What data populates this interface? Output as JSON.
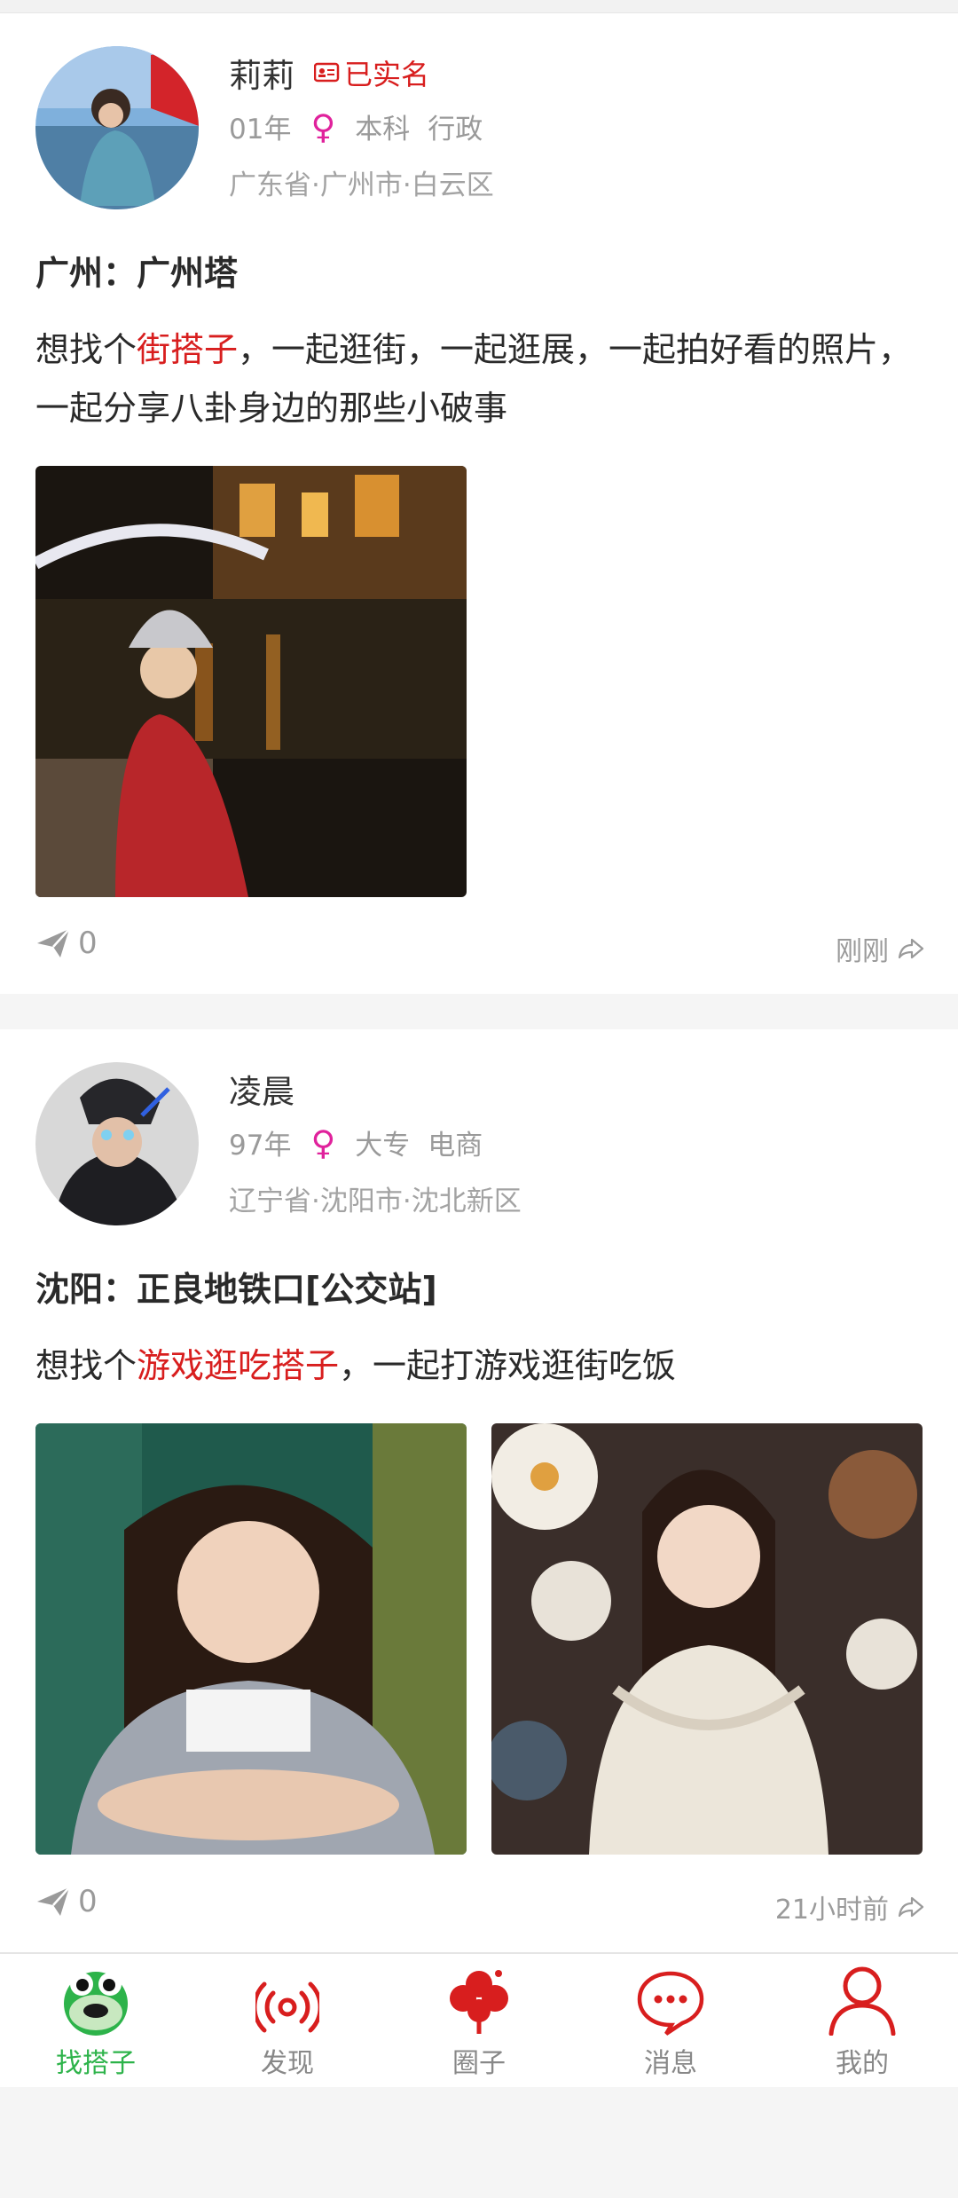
{
  "posts": [
    {
      "name": "莉莉",
      "verified_label": "已实名",
      "birth_year": "01年",
      "education": "本科",
      "job": "行政",
      "location": "广东省·广州市·白云区",
      "place": "广州：广州塔",
      "desc_prefix": "想找个",
      "desc_highlight": "街搭子",
      "desc_suffix": "，一起逛街，一起逛展，一起拍好看的照片，一起分享八卦身边的那些小破事",
      "share_count": "0",
      "time": "刚刚"
    },
    {
      "name": "凌晨",
      "birth_year": "97年",
      "education": "大专",
      "job": "电商",
      "location": "辽宁省·沈阳市·沈北新区",
      "place": "沈阳：正良地铁口[公交站]",
      "desc_prefix": "想找个",
      "desc_highlight": "游戏逛吃搭子",
      "desc_suffix": "，一起打游戏逛街吃饭",
      "share_count": "0",
      "time": "21小时前"
    }
  ],
  "tabbar": {
    "items": [
      {
        "label": "找搭子",
        "icon": "frog-icon",
        "active": true
      },
      {
        "label": "发现",
        "icon": "broadcast-icon"
      },
      {
        "label": "圈子",
        "icon": "clover-icon"
      },
      {
        "label": "消息",
        "icon": "chat-bubble-icon"
      },
      {
        "label": "我的",
        "icon": "user-icon"
      }
    ]
  },
  "colors": {
    "accent_red": "#d81e1e",
    "active_green": "#2db34a",
    "female_pink": "#e0229c"
  }
}
